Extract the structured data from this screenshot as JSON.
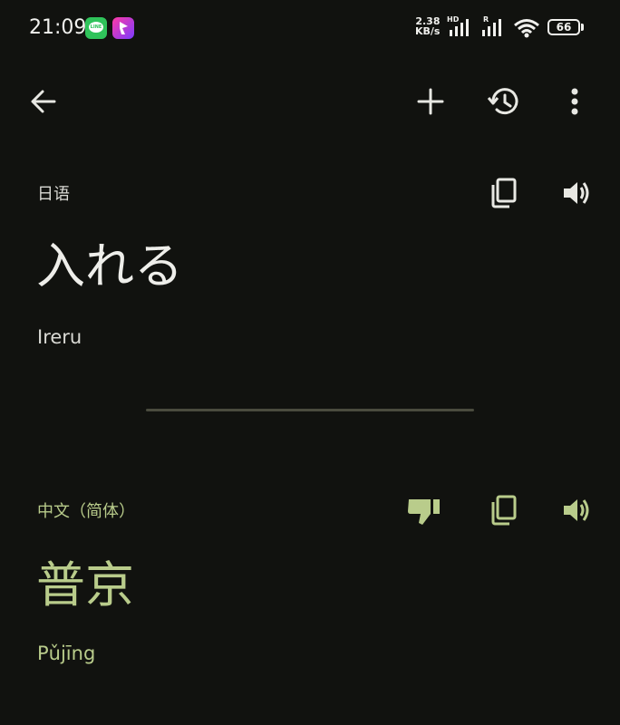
{
  "status_bar": {
    "time": "21:09",
    "net_speed_value": "2.38",
    "net_speed_unit": "KB/s",
    "network_type": "HD",
    "roaming": "R",
    "battery": "66",
    "line_badge_text": "LINE"
  },
  "toolbar": {
    "back_icon": "arrow-back-icon",
    "add_icon": "plus-icon",
    "history_icon": "history-icon",
    "more_icon": "more-vert-icon"
  },
  "source": {
    "language": "日语",
    "text": "入れる",
    "transliteration": "Ireru"
  },
  "target": {
    "language": "中文（简体）",
    "text": "普京",
    "transliteration": "Pǔjīng"
  },
  "colors": {
    "background": "#11120f",
    "accent": "#b9cc8b",
    "divider": "#4a4b3e"
  }
}
